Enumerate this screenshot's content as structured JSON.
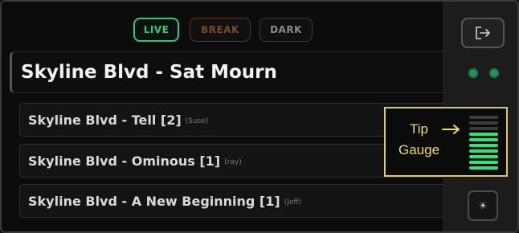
{
  "status": {
    "live": "LIVE",
    "break": "BREAK",
    "dark": "DARK",
    "active": "LIVE",
    "colors": {
      "live": "#2ecc71",
      "break": "#7a4b22",
      "dark": "#8a8a8a"
    }
  },
  "current_cue": "Skyline Blvd - Sat Mourn",
  "list": [
    {
      "name": "Skyline Blvd - Tell [2]",
      "who": "(Suse)"
    },
    {
      "name": "Skyline Blvd - Ominous [1]",
      "who": "(ray)"
    },
    {
      "name": "Skyline Blvd - A New Beginning [1]",
      "who": "(Jeff)"
    }
  ],
  "rail": {
    "exit_icon": "exit-icon",
    "indicators": [
      "green",
      "green"
    ],
    "small_button_glyph": "☀"
  },
  "tip_gauge": {
    "label_line1": "Tip",
    "label_line2": "Gauge",
    "arrow": "→",
    "total_bars": 10,
    "lit_bars": 7,
    "accent": "#f0dc5a",
    "lit_color": "#2ee37a"
  }
}
